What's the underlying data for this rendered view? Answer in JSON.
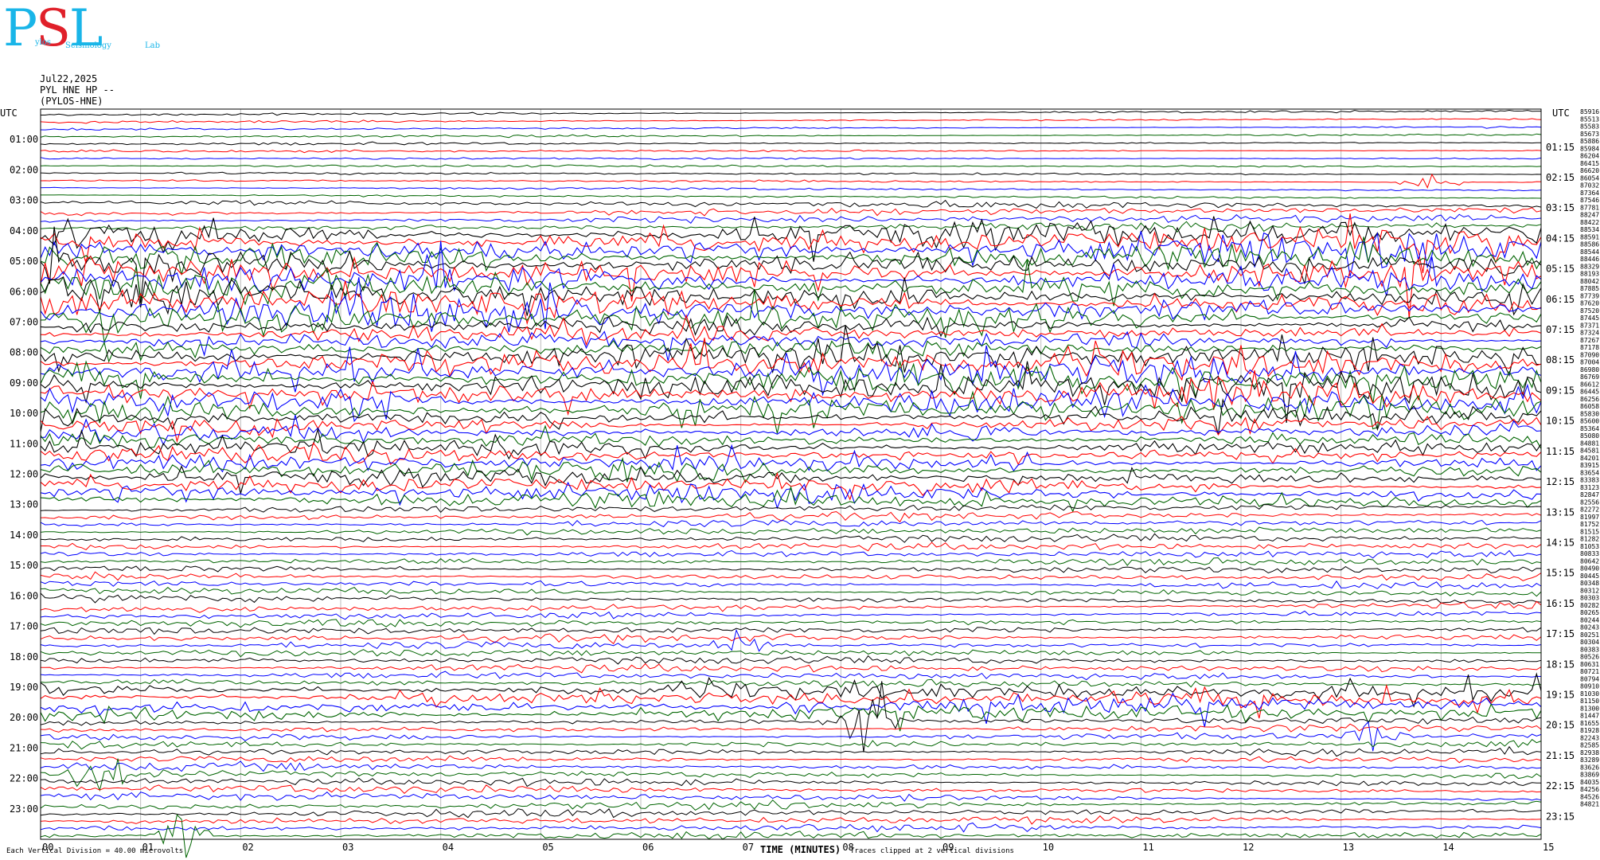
{
  "logo": {
    "letters": [
      "P",
      "S",
      "L"
    ],
    "words": [
      "ylos",
      "Seismology",
      "Lab"
    ]
  },
  "header": {
    "date": "Jul22,2025",
    "station": "PYL HNE HP --",
    "site": "(PYLOS-HNE)"
  },
  "utc_label": "UTC",
  "left_hours": [
    "01:00",
    "02:00",
    "03:00",
    "04:00",
    "05:00",
    "06:00",
    "07:00",
    "08:00",
    "09:00",
    "10:00",
    "11:00",
    "12:00",
    "13:00",
    "14:00",
    "15:00",
    "16:00",
    "17:00",
    "18:00",
    "19:00",
    "20:00",
    "21:00",
    "22:00",
    "23:00"
  ],
  "right_hours": [
    "01:15",
    "02:15",
    "03:15",
    "04:15",
    "05:15",
    "06:15",
    "07:15",
    "08:15",
    "09:15",
    "10:15",
    "11:15",
    "12:15",
    "13:15",
    "14:15",
    "15:15",
    "16:15",
    "17:15",
    "18:15",
    "19:15",
    "20:15",
    "21:15",
    "22:15",
    "23:15"
  ],
  "counts": [
    "85916",
    "85513",
    "85583",
    "85673",
    "85886",
    "85984",
    "86204",
    "86415",
    "86620",
    "86054",
    "87032",
    "87364",
    "87546",
    "87781",
    "88247",
    "88422",
    "88534",
    "88591",
    "88586",
    "88544",
    "88446",
    "88329",
    "88193",
    "88042",
    "87885",
    "87739",
    "87620",
    "87520",
    "87445",
    "87371",
    "87324",
    "87267",
    "87178",
    "87090",
    "87004",
    "86980",
    "86769",
    "86612",
    "86445",
    "86256",
    "86058",
    "85830",
    "85600",
    "85364",
    "85080",
    "84881",
    "84581",
    "84201",
    "83915",
    "83654",
    "83383",
    "83123",
    "82847",
    "82556",
    "82272",
    "81997",
    "81752",
    "81515",
    "81282",
    "81053",
    "80833",
    "80642",
    "80490",
    "80445",
    "80348",
    "80312",
    "80303",
    "80282",
    "80265",
    "80244",
    "80243",
    "80251",
    "80304",
    "80383",
    "80526",
    "80631",
    "80721",
    "80794",
    "80910",
    "81030",
    "81150",
    "81300",
    "81447",
    "81655",
    "81928",
    "82243",
    "82585",
    "82938",
    "83289",
    "83626",
    "83869",
    "84035",
    "84256",
    "84526",
    "84821"
  ],
  "chart_data": {
    "type": "line",
    "title": "Jul22,2025 PYL HNE HP -- (PYLOS-HNE)",
    "xlabel": "TIME (MINUTES)",
    "ylabel": "UTC",
    "x_ticks": [
      "00",
      "01",
      "02",
      "03",
      "04",
      "05",
      "06",
      "07",
      "08",
      "09",
      "10",
      "11",
      "12",
      "13",
      "14",
      "15"
    ],
    "xlim": [
      0,
      15
    ],
    "trace_colors": [
      "#000000",
      "#ff0000",
      "#0000ff",
      "#006400"
    ],
    "traces_per_hour": 4,
    "minutes_per_trace": 15,
    "footer_scale": "Each Vertical Division = 40.00 microvolts",
    "footer_note": "Traces clipped at 2 vertical divisions",
    "activity_hours": [
      0,
      0,
      0,
      1,
      3,
      3,
      3,
      2,
      3,
      3,
      2,
      2,
      2,
      1,
      1,
      1,
      1,
      1,
      1,
      2,
      1,
      1,
      1,
      1
    ],
    "events": [
      {
        "hour": 19.9,
        "minute": 8.3,
        "level": 4
      },
      {
        "hour": 20.6,
        "minute": 13.3,
        "level": 2
      },
      {
        "hour": 21.8,
        "minute": 0.6,
        "level": 3
      },
      {
        "hour": 23.7,
        "minute": 1.4,
        "level": 3
      },
      {
        "hour": 17.5,
        "minute": 7.0,
        "level": 2
      },
      {
        "hour": 2.3,
        "minute": 13.9,
        "level": 2
      }
    ]
  },
  "footer": {
    "scale": "Each Vertical Division = 40.00 microvolts",
    "note": "Traces clipped at 2 vertical divisions"
  }
}
